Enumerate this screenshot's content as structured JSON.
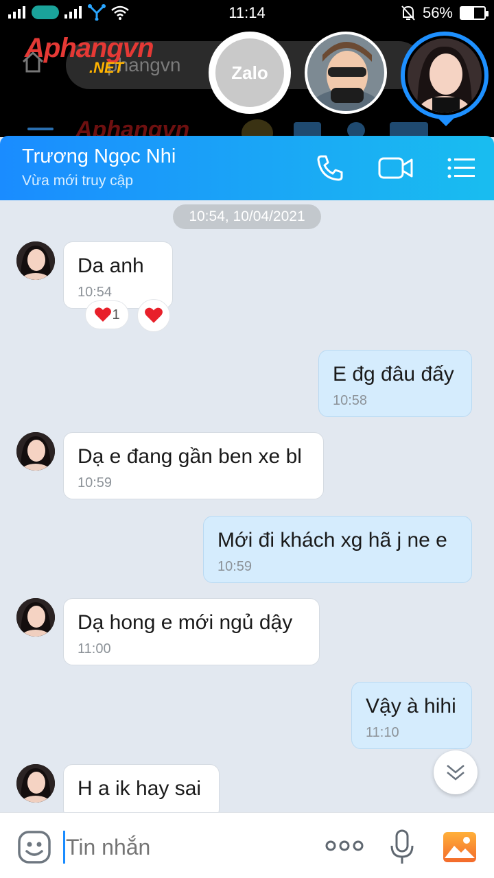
{
  "status_bar": {
    "time": "11:14",
    "battery_percent": "56%",
    "battery_level": 0.56
  },
  "background_app": {
    "url_text": "phangvn",
    "watermark": "Aphangvn",
    "watermark_domain": ".NET"
  },
  "chat_heads": {
    "zalo_label": "Zalo"
  },
  "header": {
    "contact_name": "Trương Ngọc Nhi",
    "contact_status": "Vừa mới truy cập",
    "call_icon": "phone-icon",
    "video_icon": "video-camera-icon",
    "menu_icon": "list-menu-icon"
  },
  "chat": {
    "date_chip": "10:54, 10/04/2021",
    "messages": [
      {
        "dir": "in",
        "text": "Da anh",
        "time": "10:54"
      },
      {
        "dir": "out",
        "text": "E đg đâu đấy",
        "time": "10:58"
      },
      {
        "dir": "in",
        "text": "Dạ e đang gần ben xe bl",
        "time": "10:59"
      },
      {
        "dir": "out",
        "text": "Mới đi khách xg hã j ne e",
        "time": "10:59"
      },
      {
        "dir": "in",
        "text": "Dạ hong e mới ngủ dậy",
        "time": "11:00"
      },
      {
        "dir": "out",
        "text": "Vậy à hihi",
        "time": "11:10"
      },
      {
        "dir": "in",
        "text": "H a ik hay sai",
        "time": ""
      }
    ],
    "reaction_count": "1",
    "reaction_color": "#e8202a"
  },
  "input_bar": {
    "placeholder": "Tin nhắn"
  },
  "colors": {
    "accent": "#1a8cff",
    "outgoing_bubble": "#d5ecfd",
    "incoming_bubble": "#ffffff",
    "chat_background": "#e2e8f0"
  }
}
